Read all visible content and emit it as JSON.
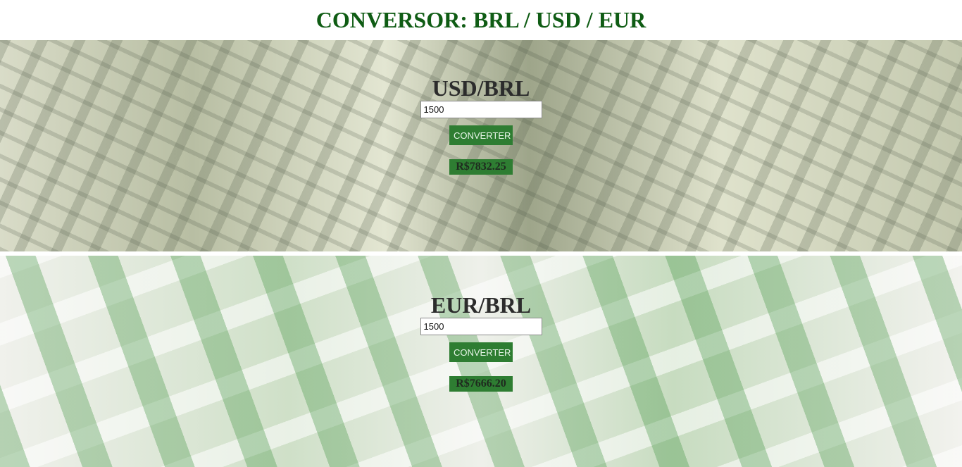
{
  "title": "CONVERSOR: BRL / USD / EUR",
  "usd_panel": {
    "pair": "USD/BRL",
    "input_value": "1500",
    "button_label": "CONVERTER",
    "result": "R$7832.25"
  },
  "eur_panel": {
    "pair": "EUR/BRL",
    "input_value": "1500",
    "button_label": "CONVERTER",
    "result": "R$7666.20"
  },
  "colors": {
    "title": "#0f5c14",
    "button_bg": "#2e7d32"
  }
}
